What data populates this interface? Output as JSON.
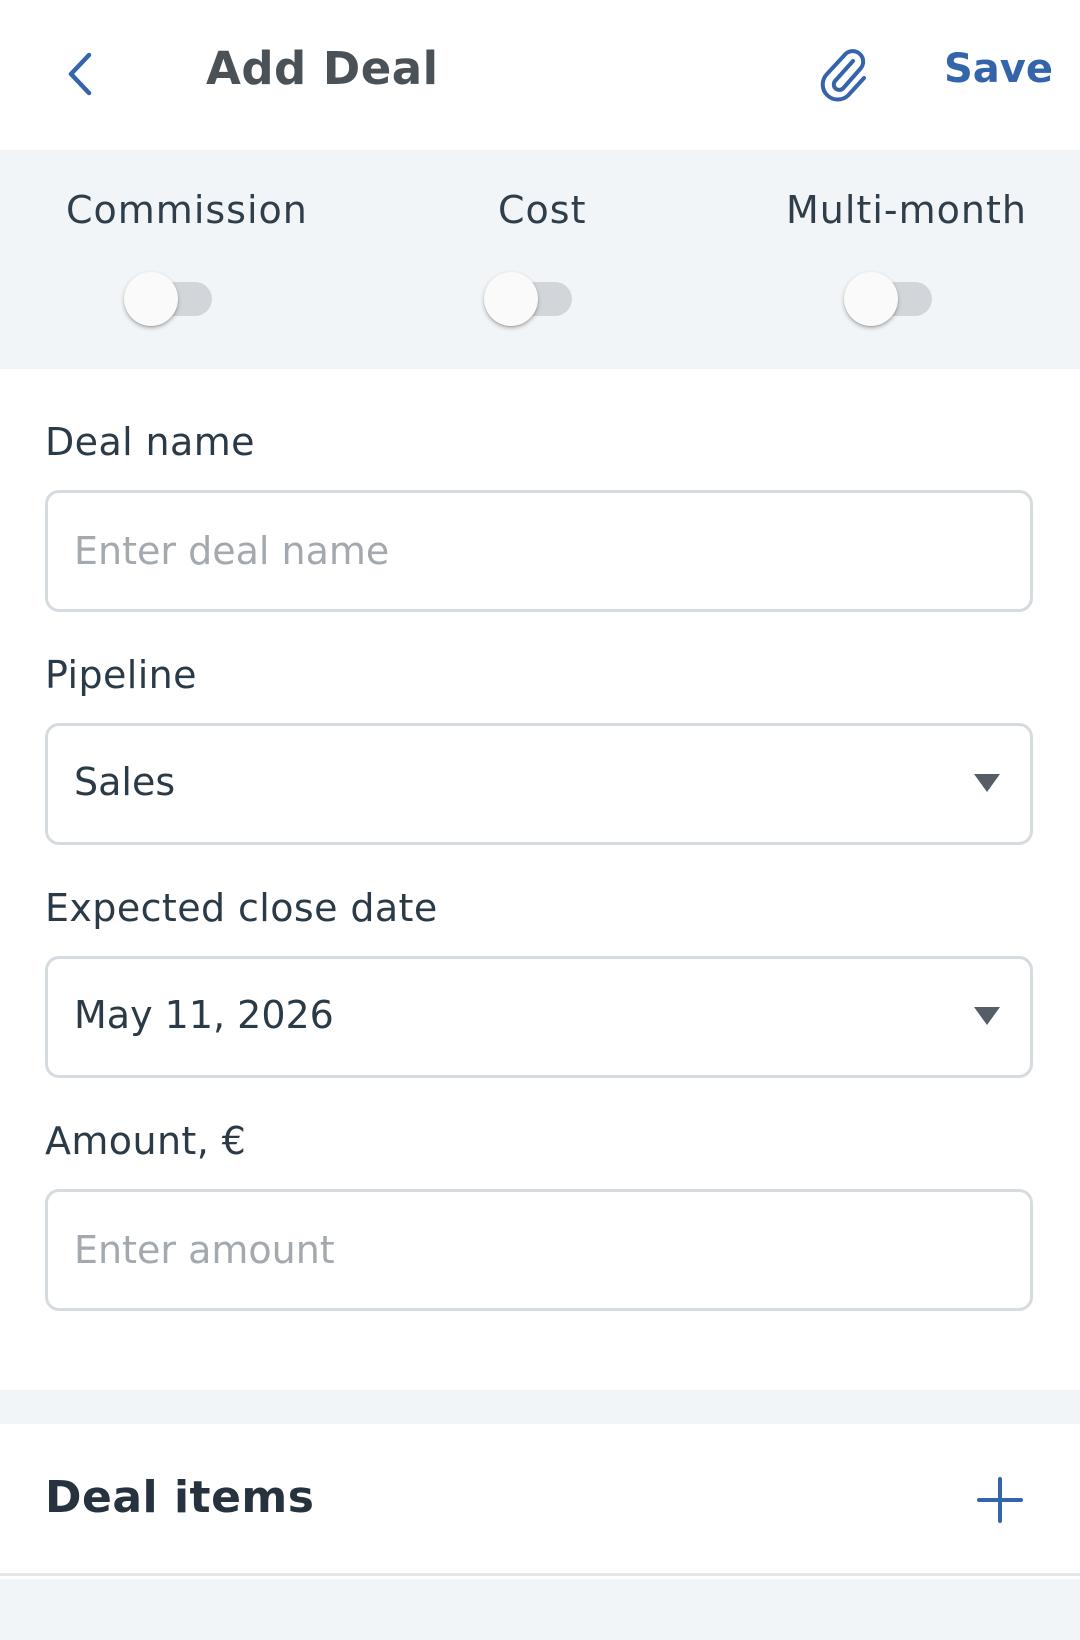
{
  "header": {
    "back_icon": "chevron-left-icon",
    "title": "Add Deal",
    "attach_icon": "paperclip-icon",
    "save_label": "Save"
  },
  "toggles": [
    {
      "label": "Commission",
      "on": false
    },
    {
      "label": "Cost",
      "on": false
    },
    {
      "label": "Multi-month",
      "on": false
    }
  ],
  "form": {
    "deal_name": {
      "label": "Deal name",
      "value": "",
      "placeholder": "Enter deal name"
    },
    "pipeline": {
      "label": "Pipeline",
      "value": "Sales"
    },
    "close_date": {
      "label": "Expected close date",
      "value": "May 11, 2026"
    },
    "amount": {
      "label": "Amount, €",
      "value": "",
      "placeholder": "Enter amount"
    }
  },
  "deal_items": {
    "title": "Deal items",
    "add_icon": "plus-icon"
  },
  "colors": {
    "accent": "#3464a9",
    "band_background": "#f2f5f8",
    "field_border": "#d6dbdf"
  }
}
